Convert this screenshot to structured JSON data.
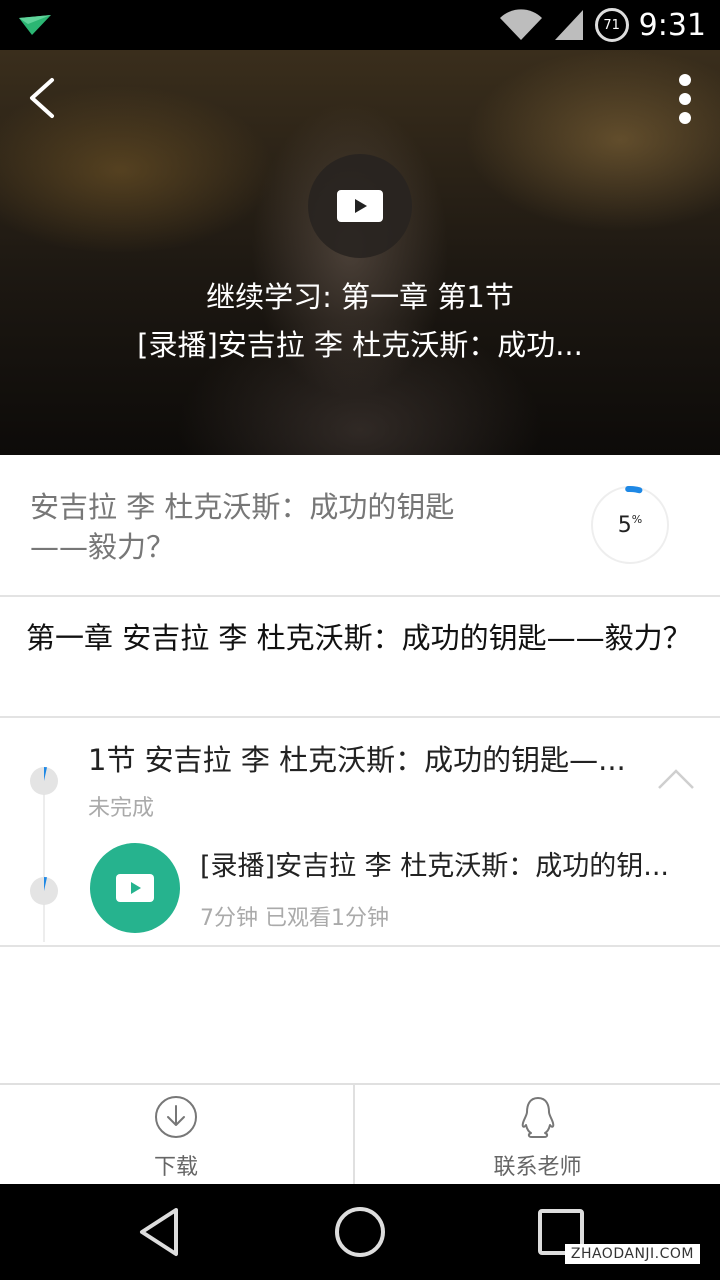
{
  "status_bar": {
    "time": "9:31",
    "battery_level": "71",
    "icons": [
      "app-notification-icon",
      "wifi-icon",
      "cell-signal-icon",
      "battery-icon"
    ]
  },
  "hero": {
    "continue_label": "继续学习: 第一章 第1节",
    "lesson_label": "[录播]安吉拉 李 杜克沃斯：成功...",
    "icons": [
      "back-arrow-icon",
      "more-vert-icon",
      "play-icon"
    ]
  },
  "course": {
    "title": "安吉拉 李 杜克沃斯：成功的钥匙——毅力？",
    "progress_number": "5",
    "progress_unit": "%",
    "progress_fraction": 0.05,
    "progress_color": "#1e88e5"
  },
  "chapter": {
    "title": "第一章 安吉拉 李 杜克沃斯：成功的钥匙——毅力？"
  },
  "section": {
    "title": "1节 安吉拉 李 杜克沃斯：成功的钥匙—...",
    "status": "未完成",
    "lesson": {
      "title": "[录播]安吉拉 李 杜克沃斯：成功的钥...",
      "meta": "7分钟 已观看1分钟",
      "play_color": "#26b38e"
    }
  },
  "actions": {
    "download_label": "下载",
    "contact_label": "联系老师",
    "icons": [
      "download-icon",
      "qq-penguin-icon"
    ]
  },
  "nav": {
    "icons": [
      "back-triangle-icon",
      "home-circle-icon",
      "recents-square-icon"
    ]
  },
  "watermark": "ZHAODANJI.COM"
}
